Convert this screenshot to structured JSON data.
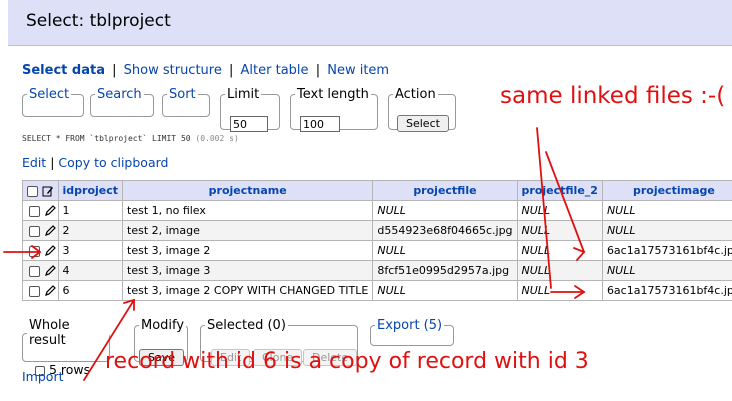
{
  "header": {
    "title": "Select: tblproject"
  },
  "nav": {
    "select_data": "Select data",
    "show_structure": "Show structure",
    "alter_table": "Alter table",
    "new_item": "New item",
    "sep": "|"
  },
  "form": {
    "select_legend": "Select",
    "search_legend": "Search",
    "sort_legend": "Sort",
    "limit_legend": "Limit",
    "limit_value": "50",
    "text_length_legend": "Text length",
    "text_length_value": "100",
    "action_legend": "Action",
    "select_button": "Select"
  },
  "query": {
    "sql": "SELECT * FROM `tblproject` LIMIT 50",
    "time": "(0.002 s)"
  },
  "edit_links": {
    "edit": "Edit",
    "copy": "Copy to clipboard",
    "sep": "|"
  },
  "table": {
    "columns": [
      "idproject",
      "projectname",
      "projectfile",
      "projectfile_2",
      "projectimage"
    ],
    "rows": [
      {
        "idproject": "1",
        "projectname": "test 1, no filex",
        "projectfile": "NULL",
        "projectfile_2": "NULL",
        "projectimage": "NULL"
      },
      {
        "idproject": "2",
        "projectname": "test 2, image",
        "projectfile": "d554923e68f04665c.jpg",
        "projectfile_2": "NULL",
        "projectimage": "NULL"
      },
      {
        "idproject": "3",
        "projectname": "test 3, image 2",
        "projectfile": "NULL",
        "projectfile_2": "NULL",
        "projectimage": "6ac1a17573161bf4c.jpg"
      },
      {
        "idproject": "4",
        "projectname": "test 3, image 3",
        "projectfile": "8fcf51e0995d2957a.jpg",
        "projectfile_2": "NULL",
        "projectimage": "NULL"
      },
      {
        "idproject": "6",
        "projectname": "test 3, image 2 COPY WITH CHANGED TITLE",
        "projectfile": "NULL",
        "projectfile_2": "NULL",
        "projectimage": "6ac1a17573161bf4c.jpg"
      }
    ]
  },
  "bottom": {
    "whole_result_legend": "Whole result",
    "rows_label": "5 rows",
    "modify_legend": "Modify",
    "save_button": "Save",
    "selected_legend": "Selected (0)",
    "edit_button": "Edit",
    "clone_button": "Clone",
    "delete_button": "Delete",
    "export_legend": "Export (5)",
    "import_link": "Import"
  },
  "annotations": {
    "top_right": "same linked files :-(",
    "bottom": "record with id 6 is a copy of record with id 3",
    "color": "#e01010"
  },
  "colors": {
    "header_bg": "#dde0f7",
    "link": "#0645ad"
  }
}
